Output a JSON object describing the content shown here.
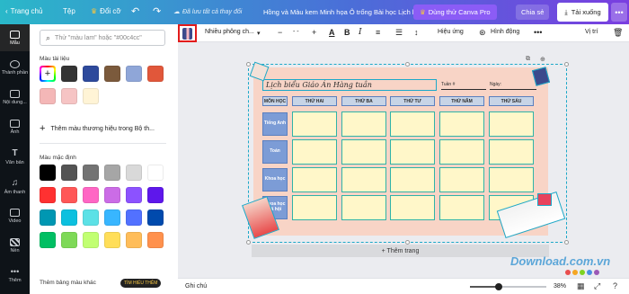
{
  "topbar": {
    "home": "Trang chủ",
    "file": "Tệp",
    "resize": "Đổi cỡ",
    "saved": "Đã lưu tất cả thay đổi",
    "title": "Hồng và Màu kem Minh họa Ô trống Bài học Lịch hàng tuần",
    "pro": "Dùng thử Canva Pro",
    "share": "Chia sẻ",
    "download": "Tải xuống"
  },
  "rail": {
    "items": [
      "Mẫu",
      "Thành phần",
      "Nội dung...",
      "Ảnh",
      "Văn bản",
      "Âm thanh",
      "Video",
      "Nền",
      "Thêm"
    ]
  },
  "panel": {
    "search_placeholder": "Thử \"màu lam\" hoặc \"#00c4cc\"",
    "doc_colors_label": "Màu tài liệu",
    "doc_colors": [
      "#343434",
      "#2e4a9c",
      "#7b5a3c",
      "#8fa6d8",
      "#e1573a",
      "#f4b7b7",
      "#f6c4c4",
      "#fff4d6"
    ],
    "brand_add": "Thêm màu thương hiệu trong Bộ th...",
    "default_label": "Màu mặc định",
    "default_colors": [
      "#000000",
      "#545454",
      "#737373",
      "#a6a6a6",
      "#d9d9d9",
      "#ffffff",
      "#ff3131",
      "#ff5757",
      "#ff66c4",
      "#cb6ce6",
      "#8c52ff",
      "#5e17eb",
      "#0097b2",
      "#0cc0df",
      "#5ce1e6",
      "#38b6ff",
      "#5271ff",
      "#004aad",
      "#00bf63",
      "#7ed957",
      "#c1ff72",
      "#ffde59",
      "#ffbd59",
      "#ff914d"
    ],
    "footer": "Thêm bảng màu khác",
    "pro_tag": "TÌM HIỂU THÊM"
  },
  "editbar": {
    "font": "Nhiều phông ch...",
    "size": "- -",
    "effects": "Hiệu ứng",
    "position_label": "Vị trí",
    "animate": "Hình động"
  },
  "canvas": {
    "plan_title": "Lịch biểu Giáo Án Hàng tuần",
    "week_label": "Tuần #",
    "date_label": "Ngày:",
    "columns": [
      "MÔN HỌC",
      "THỨ HAI",
      "THỨ BA",
      "THỨ TƯ",
      "THỨ NĂM",
      "THỨ SÁU"
    ],
    "rows": [
      "Tiếng Anh",
      "Toán",
      "Khoa học",
      "Khoa học xã hội"
    ],
    "add_page": "+ Thêm trang"
  },
  "statusbar": {
    "notes": "Ghi chú",
    "zoom_value": 38,
    "zoom_text": "38%"
  },
  "watermark": {
    "text": "Download.com.vn",
    "dots": [
      "#e94e4e",
      "#f5a623",
      "#7ed321",
      "#4a90e2",
      "#9b59b6"
    ]
  }
}
